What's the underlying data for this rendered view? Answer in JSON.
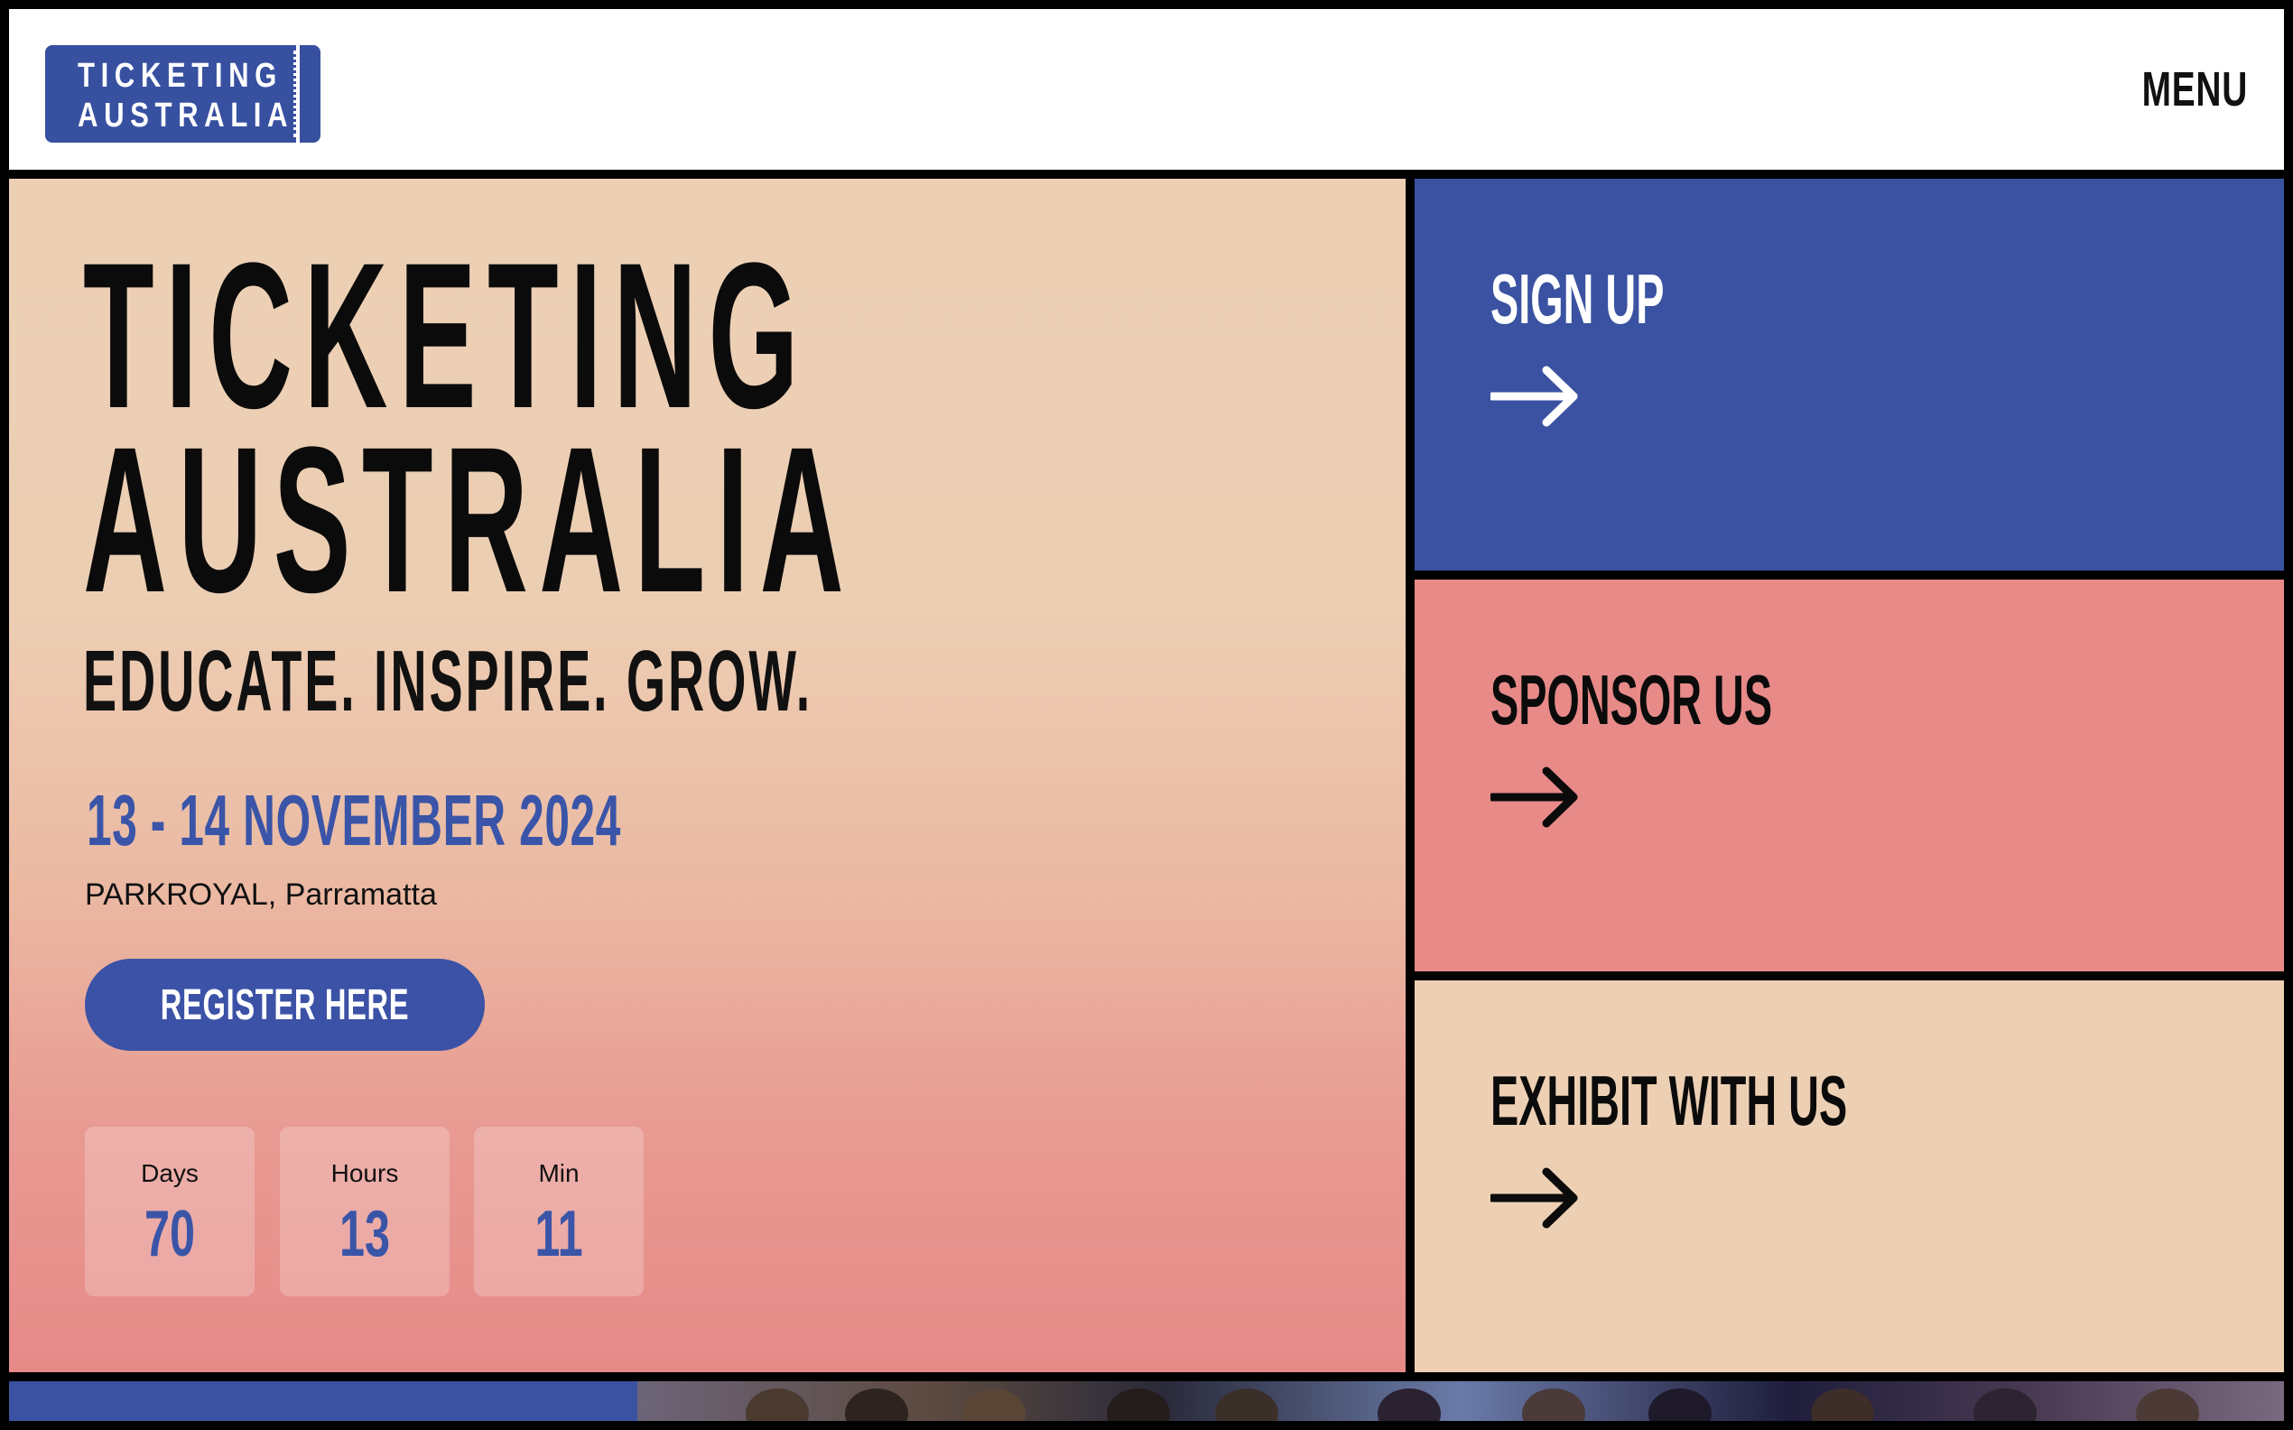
{
  "header": {
    "logo_line1": "TICKETING",
    "logo_line2": "AUSTRALIA",
    "menu_label": "MENU"
  },
  "hero": {
    "title_line1": "TICKETING",
    "title_line2": "AUSTRALIA",
    "tagline": "EDUCATE. INSPIRE. GROW.",
    "date": "13 - 14 NOVEMBER 2024",
    "venue": "PARKROYAL, Parramatta",
    "register_label": "REGISTER HERE",
    "countdown": [
      {
        "label": "Days",
        "value": "70"
      },
      {
        "label": "Hours",
        "value": "13"
      },
      {
        "label": "Min",
        "value": "11"
      }
    ]
  },
  "cards": [
    {
      "title": "SIGN UP",
      "icon": "arrow-right-icon"
    },
    {
      "title": "SPONSOR US",
      "icon": "arrow-right-icon"
    },
    {
      "title": "EXHIBIT WITH US",
      "icon": "arrow-right-icon"
    }
  ],
  "colors": {
    "brand_blue": "#3a52a1",
    "coral": "#e78a88",
    "sand": "#edd0b4",
    "accent_text_blue": "#3a55a8"
  }
}
